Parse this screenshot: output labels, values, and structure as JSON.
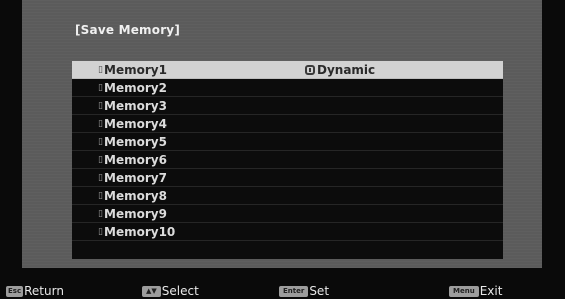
{
  "screen": {
    "title": "[Save Memory]"
  },
  "memories": [
    {
      "marker": "▯",
      "name": "Memory1",
      "mode": "Dynamic",
      "selected": true
    },
    {
      "marker": "▯",
      "name": "Memory2",
      "mode": ""
    },
    {
      "marker": "▯",
      "name": "Memory3",
      "mode": ""
    },
    {
      "marker": "▯",
      "name": "Memory4",
      "mode": ""
    },
    {
      "marker": "▯",
      "name": "Memory5",
      "mode": ""
    },
    {
      "marker": "▯",
      "name": "Memory6",
      "mode": ""
    },
    {
      "marker": "▯",
      "name": "Memory7",
      "mode": ""
    },
    {
      "marker": "▯",
      "name": "Memory8",
      "mode": ""
    },
    {
      "marker": "▯",
      "name": "Memory9",
      "mode": ""
    },
    {
      "marker": "▯",
      "name": "Memory10",
      "mode": ""
    }
  ],
  "footer": {
    "return_key": "Esc",
    "return_label": "Return",
    "select_key": "▲▼",
    "select_label": "Select",
    "set_key": "Enter",
    "set_label": "Set",
    "exit_key": "Menu",
    "exit_label": "Exit"
  },
  "colors": {
    "panel": "#5b5b5b",
    "list_bg": "#0c0c0c",
    "selected_row": "#d2d2d2",
    "text": "#dcdcdc"
  }
}
